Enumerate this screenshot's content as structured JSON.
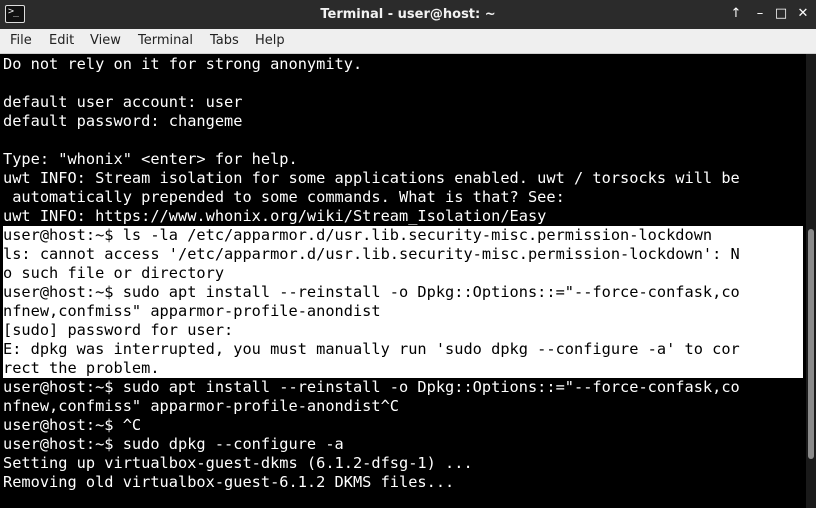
{
  "window": {
    "title": "Terminal - user@host: ~",
    "app_icon_glyph": ">_",
    "controls": {
      "up": "↑",
      "minimize": "–",
      "maximize": "□",
      "close": "✕"
    }
  },
  "menu": [
    "File",
    "Edit",
    "View",
    "Terminal",
    "Tabs",
    "Help"
  ],
  "terminal": {
    "lines": [
      {
        "text": "Do not rely on it for strong anonymity.",
        "selected": false
      },
      {
        "text": "",
        "selected": false
      },
      {
        "text": "default user account: user",
        "selected": false
      },
      {
        "text": "default password: changeme",
        "selected": false
      },
      {
        "text": "",
        "selected": false
      },
      {
        "text": "Type: \"whonix\" <enter> for help.",
        "selected": false
      },
      {
        "text": "uwt INFO: Stream isolation for some applications enabled. uwt / torsocks will be",
        "selected": false
      },
      {
        "text": " automatically prepended to some commands. What is that? See:",
        "selected": false
      },
      {
        "text": "uwt INFO: https://www.whonix.org/wiki/Stream_Isolation/Easy",
        "selected": false
      },
      {
        "text": "user@host:~$ ls -la /etc/apparmor.d/usr.lib.security-misc.permission-lockdown",
        "selected": true
      },
      {
        "text": "ls: cannot access '/etc/apparmor.d/usr.lib.security-misc.permission-lockdown': N",
        "selected": true
      },
      {
        "text": "o such file or directory",
        "selected": true
      },
      {
        "text": "user@host:~$ sudo apt install --reinstall -o Dpkg::Options::=\"--force-confask,co",
        "selected": true
      },
      {
        "text": "nfnew,confmiss\" apparmor-profile-anondist",
        "selected": true
      },
      {
        "text": "[sudo] password for user:",
        "selected": true
      },
      {
        "text": "E: dpkg was interrupted, you must manually run 'sudo dpkg --configure -a' to cor",
        "selected": true
      },
      {
        "text": "rect the problem.",
        "selected": true
      },
      {
        "text": "user@host:~$ sudo apt install --reinstall -o Dpkg::Options::=\"--force-confask,co",
        "selected": false
      },
      {
        "text": "nfnew,confmiss\" apparmor-profile-anondist^C",
        "selected": false
      },
      {
        "text": "user@host:~$ ^C",
        "selected": false
      },
      {
        "text": "user@host:~$ sudo dpkg --configure -a",
        "selected": false
      },
      {
        "text": "Setting up virtualbox-guest-dkms (6.1.2-dfsg-1) ...",
        "selected": false
      },
      {
        "text": "Removing old virtualbox-guest-6.1.2 DKMS files...",
        "selected": false
      }
    ]
  },
  "colors": {
    "terminal_bg": "#000000",
    "terminal_fg": "#ffffff",
    "selection_bg": "#ffffff",
    "selection_fg": "#000000",
    "titlebar_bg": "#2b2b2b",
    "menubar_bg": "#efefef"
  }
}
